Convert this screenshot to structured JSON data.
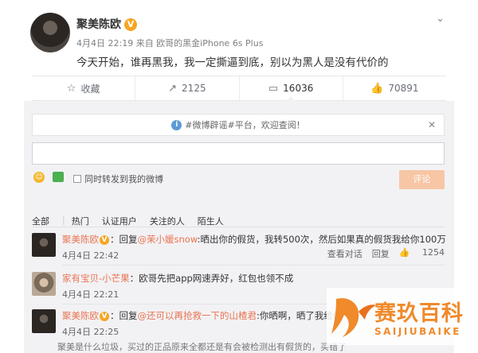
{
  "post": {
    "author": "聚美陈欧",
    "verified_badge": "V",
    "meta": "4月4日 22:19 来自 欧哥的黑金iPhone 6s Plus",
    "text": "今天开始，谁再黑我，我一定撕逼到底，别以为黑人是没有代价的"
  },
  "actions": {
    "favorite": "收藏",
    "repost": "2125",
    "comment": "16036",
    "like": "70891"
  },
  "panel": {
    "notice": "#微博辟谣#平台，欢迎查阅！",
    "forward_label": "同时转发到我的微博",
    "submit": "评论",
    "filters": [
      "全部",
      "热门",
      "认证用户",
      "关注的人",
      "陌生人"
    ]
  },
  "comments": [
    {
      "name": "聚美陈欧",
      "reply_prefix": "：回复",
      "mention": "@茉小媛snow",
      "text": ":晒出你的假货，我转500次，然后如果真的假货我给你100万",
      "time": "4月4日 22:42",
      "op_view": "查看对话",
      "op_reply": "回复",
      "likes": "1254"
    },
    {
      "name": "家有宝贝-小芒果",
      "text": "：欧哥先把app网速弄好，红包也领不成",
      "time": "4月4日 22:21"
    },
    {
      "name": "聚美陈欧",
      "reply_prefix": "：回复",
      "mention": "@还可以再抢救一下的山楂君",
      "text": ":你晒啊，晒了我给你",
      "time": "4月4日 22:25"
    }
  ],
  "truncated_line": "聚美是什么垃圾，买过的正品原来全都还是有会被检测出有假货的，买错了",
  "watermark": {
    "title": "赛玖百科",
    "subtitle": "SAIJIUBAIKE"
  },
  "colors": {
    "accent": "#eb7350",
    "badge": "#f5a623",
    "submit_disabled": "#f7c6a5",
    "watermark": "#f08a2b"
  }
}
